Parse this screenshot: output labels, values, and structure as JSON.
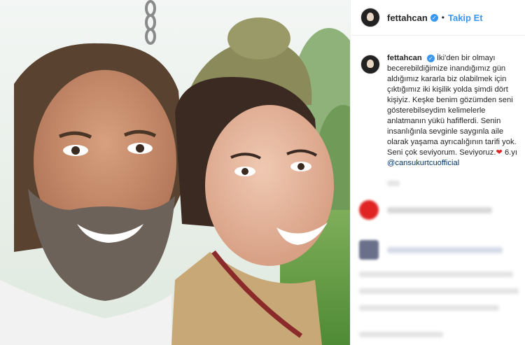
{
  "post": {
    "username": "fettahcan",
    "follow_label": "Takip Et",
    "caption_lines": [
      "İki'den bir olmayı",
      "becerebildiğimize inandığımız gün",
      "aldığımız kararla biz olabilmek için",
      "çıktığımız iki kişilik yolda şimdi dört",
      "kişiyiz. Keşke benim gözümden seni",
      "gösterebilseydim kelimelerle",
      "anlatmanın yükü hafiflerdi. Senin",
      "insanlığınla sevginle saygınla aile",
      "olarak yaşama ayrıcalığının tarifi yok.",
      "Seni çok seviyorum. Seviyoruz."
    ],
    "caption_tail": "6.yı",
    "mention": "@cansukurtcuofficial"
  },
  "icons": {
    "verified": "verified-badge-icon",
    "heart": "red-heart-emoji"
  },
  "colors": {
    "accent": "#3897f0",
    "text": "#262626",
    "mention": "#003569",
    "heart": "#e02424"
  }
}
